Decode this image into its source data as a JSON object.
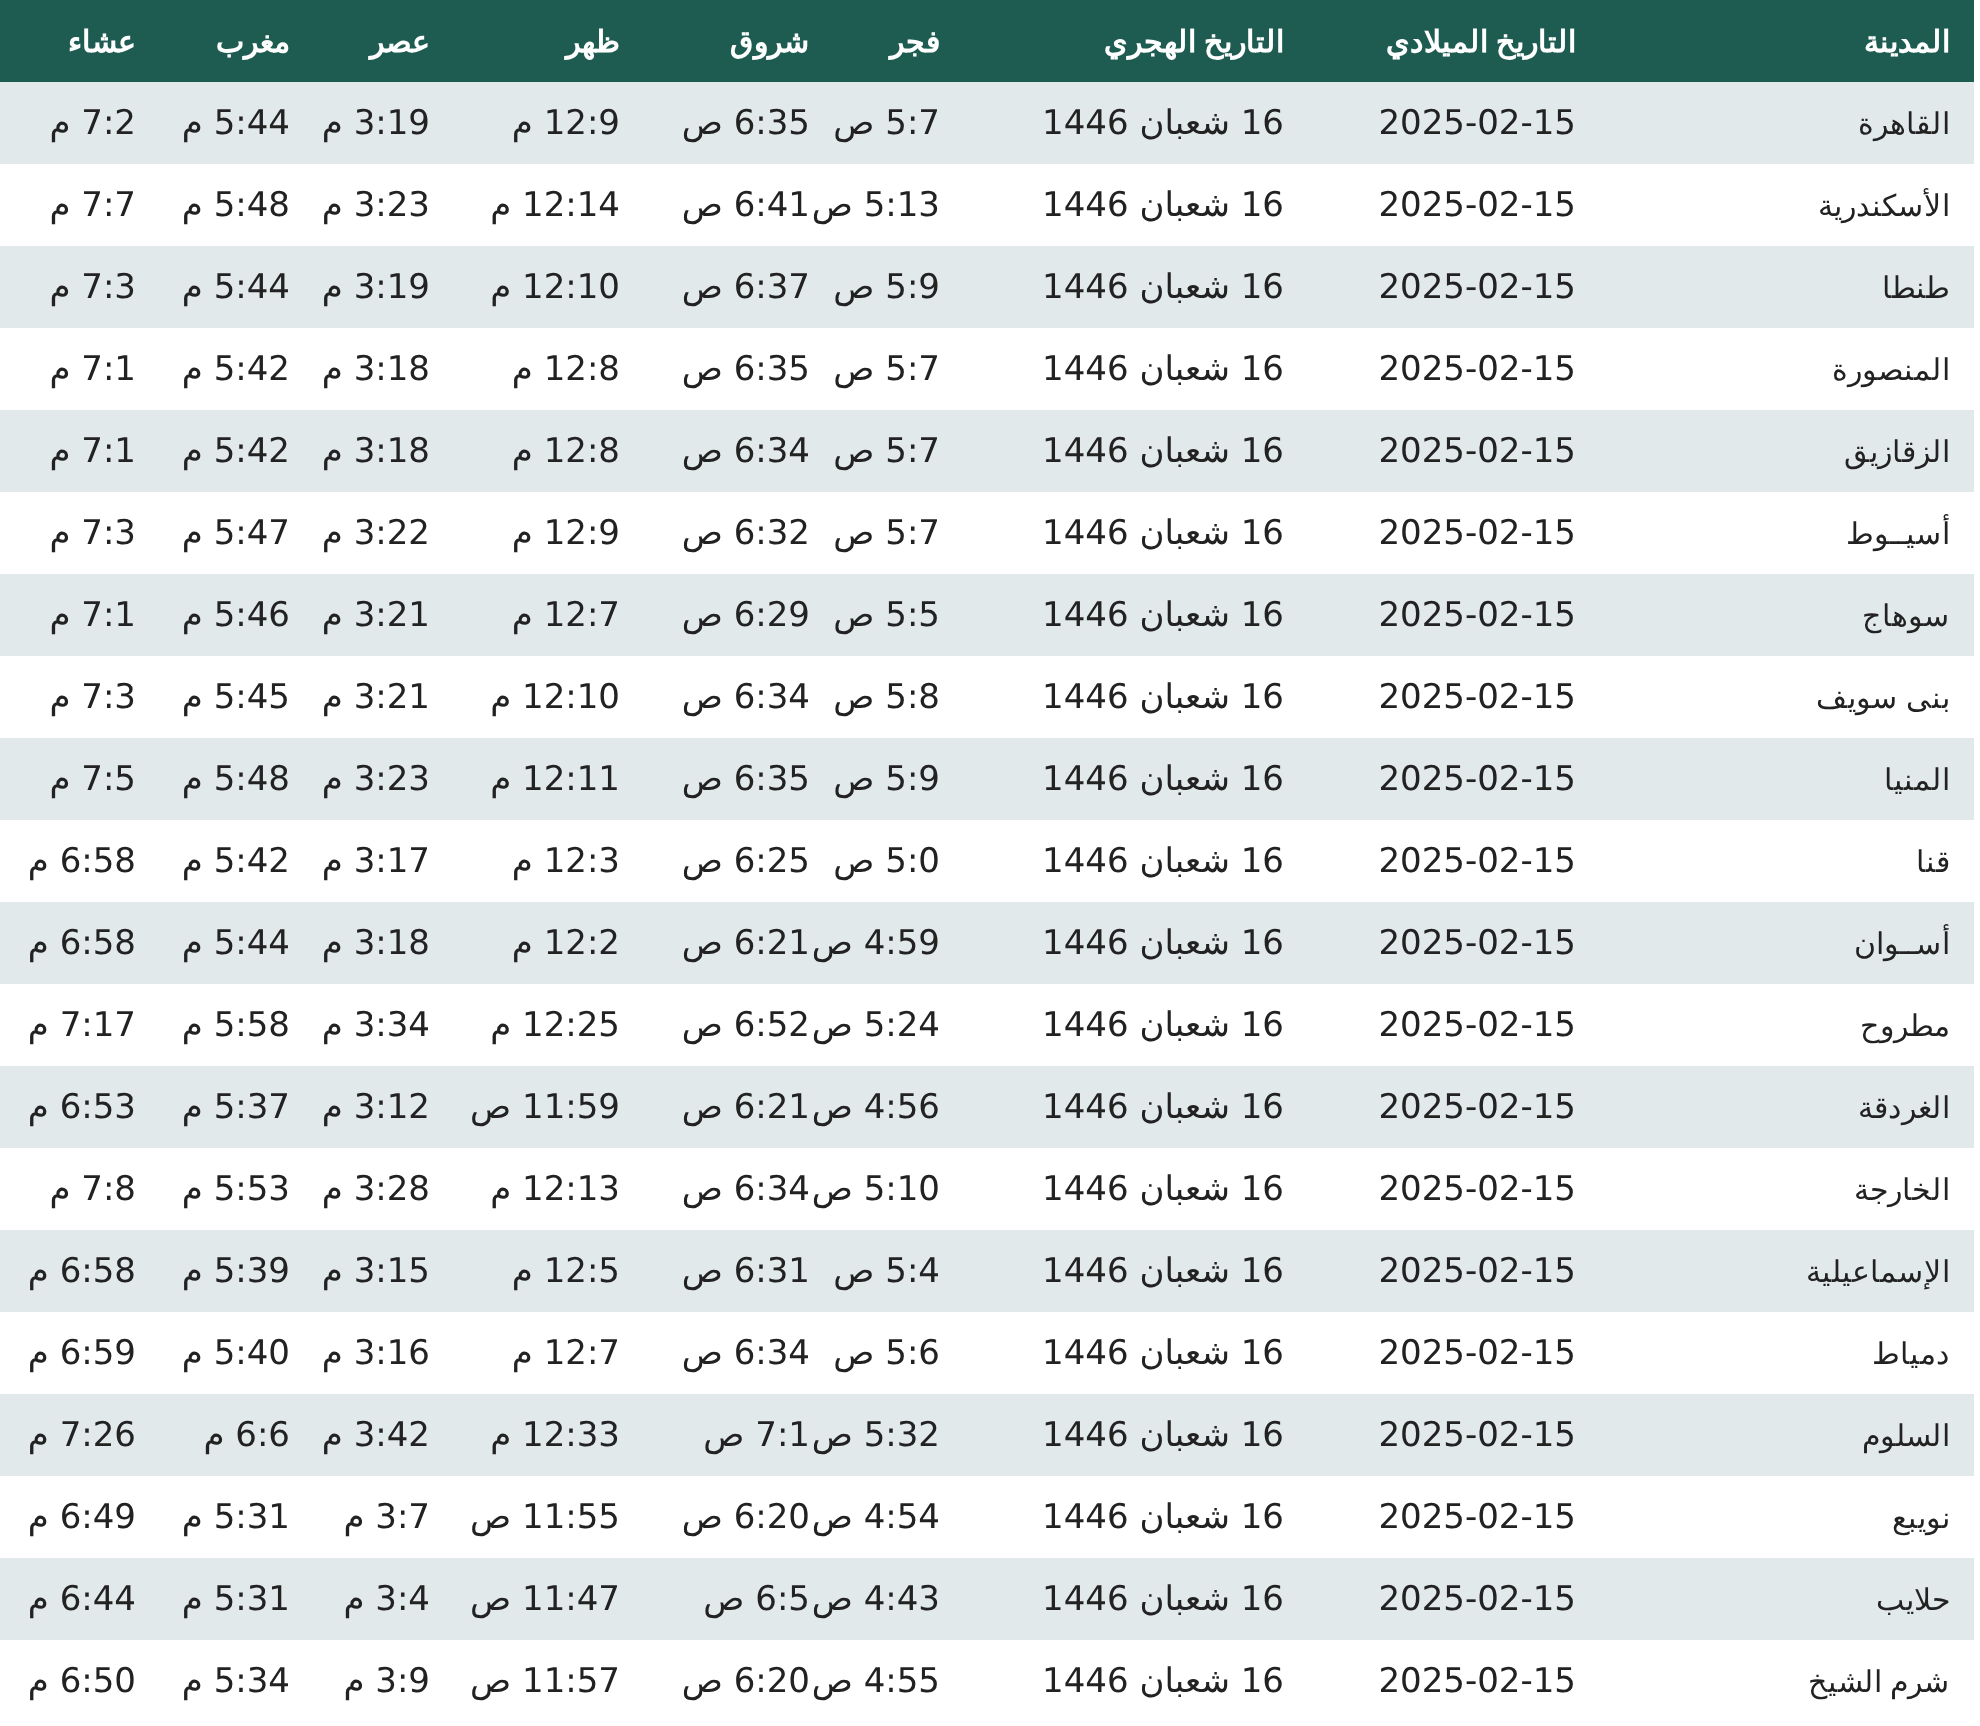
{
  "table": {
    "columns": [
      "المدينة",
      "التاريخ الميلادي",
      "التاريخ الهجري",
      "فجر",
      "شروق",
      "ظهر",
      "عصر",
      "مغرب",
      "عشاء"
    ],
    "rows": [
      [
        "القاهرة",
        "2025-02-15",
        "16 شعبان 1446",
        "5:7 ص",
        "6:35 ص",
        "12:9 م",
        "3:19 م",
        "5:44 م",
        "7:2 م"
      ],
      [
        "الأسكندرية",
        "2025-02-15",
        "16 شعبان 1446",
        "5:13 ص",
        "6:41 ص",
        "12:14 م",
        "3:23 م",
        "5:48 م",
        "7:7 م"
      ],
      [
        "طنطا",
        "2025-02-15",
        "16 شعبان 1446",
        "5:9 ص",
        "6:37 ص",
        "12:10 م",
        "3:19 م",
        "5:44 م",
        "7:3 م"
      ],
      [
        "المنصورة",
        "2025-02-15",
        "16 شعبان 1446",
        "5:7 ص",
        "6:35 ص",
        "12:8 م",
        "3:18 م",
        "5:42 م",
        "7:1 م"
      ],
      [
        "الزقازيق",
        "2025-02-15",
        "16 شعبان 1446",
        "5:7 ص",
        "6:34 ص",
        "12:8 م",
        "3:18 م",
        "5:42 م",
        "7:1 م"
      ],
      [
        "أسيــوط",
        "2025-02-15",
        "16 شعبان 1446",
        "5:7 ص",
        "6:32 ص",
        "12:9 م",
        "3:22 م",
        "5:47 م",
        "7:3 م"
      ],
      [
        "سوهاج",
        "2025-02-15",
        "16 شعبان 1446",
        "5:5 ص",
        "6:29 ص",
        "12:7 م",
        "3:21 م",
        "5:46 م",
        "7:1 م"
      ],
      [
        "بنى سويف",
        "2025-02-15",
        "16 شعبان 1446",
        "5:8 ص",
        "6:34 ص",
        "12:10 م",
        "3:21 م",
        "5:45 م",
        "7:3 م"
      ],
      [
        "المنيا",
        "2025-02-15",
        "16 شعبان 1446",
        "5:9 ص",
        "6:35 ص",
        "12:11 م",
        "3:23 م",
        "5:48 م",
        "7:5 م"
      ],
      [
        "قنا",
        "2025-02-15",
        "16 شعبان 1446",
        "5:0 ص",
        "6:25 ص",
        "12:3 م",
        "3:17 م",
        "5:42 م",
        "6:58 م"
      ],
      [
        "أســوان",
        "2025-02-15",
        "16 شعبان 1446",
        "4:59 ص",
        "6:21 ص",
        "12:2 م",
        "3:18 م",
        "5:44 م",
        "6:58 م"
      ],
      [
        "مطروح",
        "2025-02-15",
        "16 شعبان 1446",
        "5:24 ص",
        "6:52 ص",
        "12:25 م",
        "3:34 م",
        "5:58 م",
        "7:17 م"
      ],
      [
        "الغردقة",
        "2025-02-15",
        "16 شعبان 1446",
        "4:56 ص",
        "6:21 ص",
        "11:59 ص",
        "3:12 م",
        "5:37 م",
        "6:53 م"
      ],
      [
        "الخارجة",
        "2025-02-15",
        "16 شعبان 1446",
        "5:10 ص",
        "6:34 ص",
        "12:13 م",
        "3:28 م",
        "5:53 م",
        "7:8 م"
      ],
      [
        "الإسماعيلية",
        "2025-02-15",
        "16 شعبان 1446",
        "5:4 ص",
        "6:31 ص",
        "12:5 م",
        "3:15 م",
        "5:39 م",
        "6:58 م"
      ],
      [
        "دمياط",
        "2025-02-15",
        "16 شعبان 1446",
        "5:6 ص",
        "6:34 ص",
        "12:7 م",
        "3:16 م",
        "5:40 م",
        "6:59 م"
      ],
      [
        "السلوم",
        "2025-02-15",
        "16 شعبان 1446",
        "5:32 ص",
        "7:1 ص",
        "12:33 م",
        "3:42 م",
        "6:6 م",
        "7:26 م"
      ],
      [
        "نويبع",
        "2025-02-15",
        "16 شعبان 1446",
        "4:54 ص",
        "6:20 ص",
        "11:55 ص",
        "3:7 م",
        "5:31 م",
        "6:49 م"
      ],
      [
        "حلايب",
        "2025-02-15",
        "16 شعبان 1446",
        "4:43 ص",
        "6:5 ص",
        "11:47 ص",
        "3:4 م",
        "5:31 م",
        "6:44 م"
      ],
      [
        "شرم الشيخ",
        "2025-02-15",
        "16 شعبان 1446",
        "4:55 ص",
        "6:20 ص",
        "11:57 ص",
        "3:9 م",
        "5:34 م",
        "6:50 م"
      ]
    ]
  }
}
